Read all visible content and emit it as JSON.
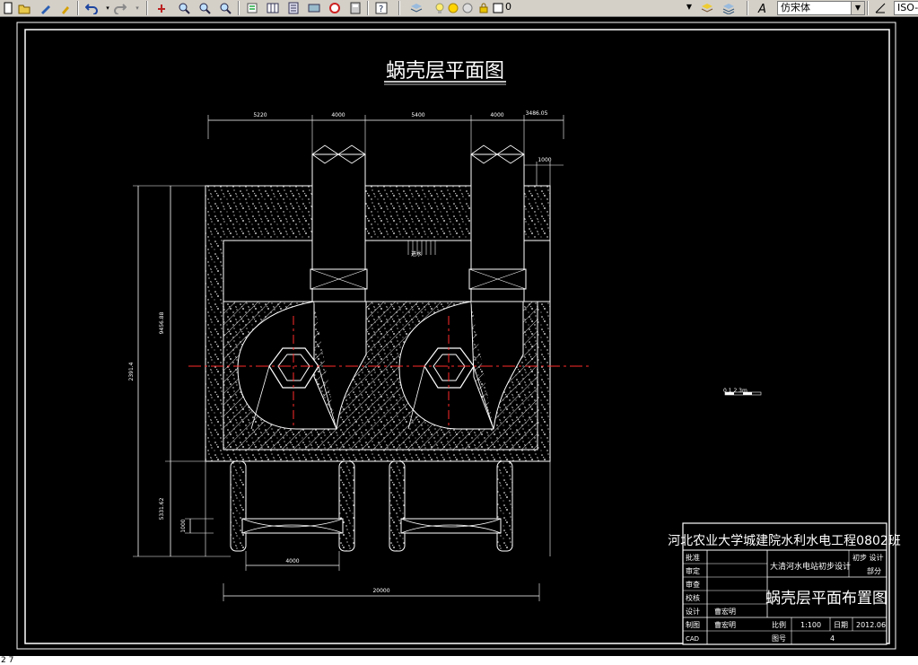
{
  "toolbar": {
    "layer_value": "0",
    "font_value": "仿宋体",
    "dim_style_value": "ISO-"
  },
  "drawing": {
    "title": "蜗壳层平面图",
    "dim_top": [
      "5220",
      "4000",
      "5400",
      "4000",
      "3486.05"
    ],
    "dim_right_small": "1000",
    "dim_left_overall": "2391.4",
    "dim_left_upper": "9456.88",
    "dim_left_lower": "5331.62",
    "dim_left_small": "1000",
    "dim_bottom_inner": "4000",
    "dim_bottom_overall": "20000",
    "scale_bar": "0 1 2 3m",
    "inlet_label": "进水"
  },
  "title_block": {
    "org": "河北农业大学城建院水利水电工程0802班",
    "project": "大清河水电站初步设计",
    "stage": "初步 设计",
    "part": "部分",
    "drawing_name": "蜗壳层平面布置图",
    "row_labels": [
      "批准",
      "审定",
      "审查",
      "校核",
      "设计",
      "制图",
      "CAD"
    ],
    "designer": "曹宏明",
    "drafter": "曹宏明",
    "scale_label": "比例",
    "scale_value": "1:100",
    "date_label": "日期",
    "date_value": "2012.06",
    "sheet_label": "图号",
    "sheet_value": "4"
  },
  "status": {
    "text": "2 7"
  }
}
